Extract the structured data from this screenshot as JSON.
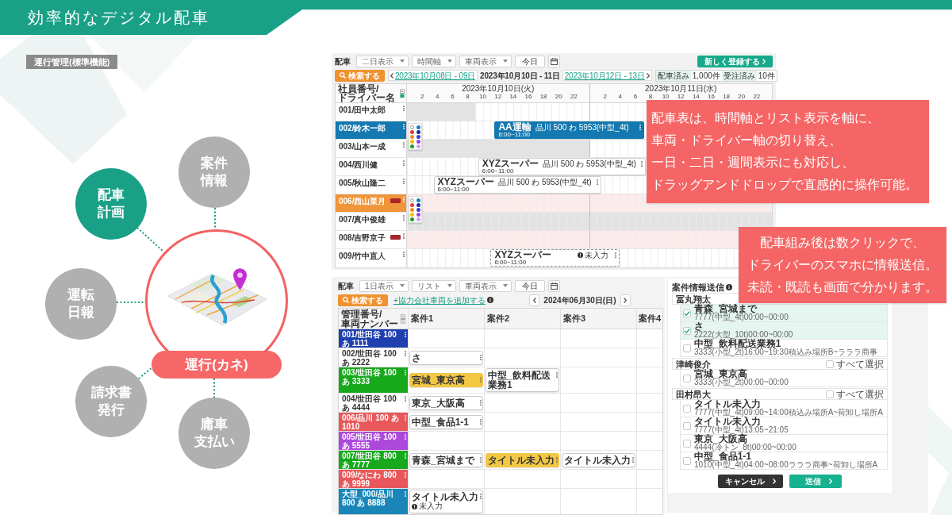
{
  "header": {
    "title": "効率的なデジタル配車"
  },
  "section_label": "運行管理(標準機能)",
  "diagram": {
    "nodes": [
      {
        "lines": [
          "配車",
          "計画"
        ],
        "selected": true
      },
      {
        "lines": [
          "案件",
          "情報"
        ],
        "selected": false
      },
      {
        "lines": [
          "運転",
          "日報"
        ],
        "selected": false
      },
      {
        "lines": [
          "請求書",
          "発行"
        ],
        "selected": false
      },
      {
        "lines": [
          "庸車",
          "支払い"
        ],
        "selected": false
      }
    ],
    "hub": {
      "label": "運行(カネ)"
    }
  },
  "dispatch_timeline": {
    "toolbar": {
      "label": "配車",
      "dropdowns": [
        "二日表示",
        "時間軸",
        "車両表示"
      ],
      "today_button": "今日",
      "new_button": "新しく登録する"
    },
    "search_button": "検索する",
    "date_nav": {
      "previous": "2023年10月08日 - 09日",
      "current": "2023年10月10日 - 11日",
      "next": "2023年10月12日 - 13日"
    },
    "stats": [
      {
        "label": "配車済み",
        "value": "1,000件"
      },
      {
        "label": "受注済み",
        "value": "10件"
      }
    ],
    "driver_header": "社員番号/ドライバー名",
    "days": [
      {
        "label": "2023年10月10日(火)",
        "hours": [
          "2",
          "4",
          "6",
          "8",
          "10",
          "12",
          "14",
          "16",
          "18",
          "20",
          "22"
        ]
      },
      {
        "label": "2023年10月11日(水)",
        "hours": [
          "2",
          "4",
          "6",
          "8",
          "10",
          "12",
          "14",
          "16",
          "18",
          "20",
          "22"
        ]
      }
    ],
    "palette_colors": [
      {
        "color": "#ffffff"
      },
      {
        "color": "#1b7db6"
      },
      {
        "color": "#e53935"
      },
      {
        "color": "#1e2a9e"
      },
      {
        "color": "#f28c28"
      },
      {
        "color": "#3b3bd6"
      },
      {
        "color": "#f2c200"
      },
      {
        "color": "#a23fe0"
      },
      {
        "color": "#1aa31a"
      },
      {
        "color": "#d79cf2"
      }
    ],
    "rows": [
      {
        "name": "001/田中太郎",
        "kind": "partial",
        "badge": false,
        "palette_open": false
      },
      {
        "name": "002/鈴木一郎",
        "color": "#1479b0",
        "kind": "open",
        "badge": false,
        "palette_open": true,
        "job": {
          "kind": "filled",
          "title": "AA運輸",
          "vehicle": "品川 500 わ 5953(中型_4t)",
          "time": "6:00~11:00"
        }
      },
      {
        "name": "003/山本一成",
        "kind": "halfblocked",
        "badge": false,
        "palette_open": false
      },
      {
        "name": "004/西川健",
        "kind": "open",
        "badge": false,
        "palette_open": false,
        "job": {
          "kind": "outline",
          "title": "XYZスーパー",
          "vehicle": "品川 500 わ 5953(中型_4t)",
          "time": "6:00~11:00"
        }
      },
      {
        "name": "005/秋山隆二",
        "kind": "open",
        "badge": false,
        "palette_open": false,
        "job": {
          "kind": "outline",
          "title": "XYZスーパー",
          "vehicle": "品川 500 わ 5953(中型_4t)",
          "time": "6:00~11:00"
        }
      },
      {
        "name": "006/西山菜月",
        "color": "#f0953a",
        "kind": "holiday",
        "badge": true,
        "palette_open": true
      },
      {
        "name": "007/真中俊雄",
        "kind": "blocked",
        "badge": false,
        "palette_open": false
      },
      {
        "name": "008/吉野京子",
        "kind": "holiday",
        "badge": true,
        "palette_open": false
      },
      {
        "name": "009/竹中直人",
        "kind": "open",
        "badge": false,
        "palette_open": false,
        "job": {
          "kind": "dashed",
          "title": "XYZスーパー",
          "status": "未入力",
          "time": "6:00~11:00"
        }
      }
    ]
  },
  "dispatch_list": {
    "toolbar": {
      "label": "配車",
      "dropdowns": [
        "1日表示",
        "リスト",
        "車両表示"
      ],
      "today_button": "今日"
    },
    "search_button": "検索する",
    "add_link": "+協力会社車両を追加する",
    "date": "2024年06月30日(日)",
    "columns": [
      "管理番号/車両ナンバー",
      "案件1",
      "案件2",
      "案件3",
      "案件4"
    ],
    "rows": [
      {
        "vehicle": "001/世田谷 100 あ 1111",
        "color": "#1f3fae"
      },
      {
        "vehicle": "002/世田谷 100 あ 2222",
        "jobs": [
          {
            "title": "さ",
            "kind": "plain"
          }
        ]
      },
      {
        "vehicle": "003/世田谷 100 あ 3333",
        "color": "#17a81c",
        "jobs": [
          {
            "title": "宮城_東京高",
            "kind": "highlight"
          },
          {
            "title": "中型_飲料配送業務1",
            "kind": "plain"
          }
        ]
      },
      {
        "vehicle": "004/世田谷 100 あ 4444",
        "jobs": [
          {
            "title": "東京_大阪高",
            "kind": "plain"
          }
        ]
      },
      {
        "vehicle": "006/品川 100 あ 1010",
        "color": "#e8585a",
        "jobs": [
          {
            "title": "中型_食品1-1",
            "kind": "plain"
          }
        ]
      },
      {
        "vehicle": "005/世田谷 100 あ 5555",
        "color": "#ac48dc"
      },
      {
        "vehicle": "007/世田谷 800 あ 7777",
        "color": "#17a81c",
        "jobs": [
          {
            "title": "青森_宮城まで",
            "kind": "plain"
          },
          {
            "title": "タイトル未入力",
            "kind": "highlight"
          },
          {
            "title": "タイトル未入力",
            "kind": "plain"
          }
        ]
      },
      {
        "vehicle": "009/なにわ 800 あ 9999",
        "color": "#e8585a"
      },
      {
        "vehicle": "大型_000/品川 800 あ 8888",
        "color": "#1a86b8",
        "jobs": [
          {
            "title": "タイトル未入力",
            "kind": "plain",
            "status": "未入力"
          }
        ]
      }
    ]
  },
  "send_panel": {
    "title": "案件情報送信",
    "groups": [
      {
        "name": "冨丸翔太",
        "items": [
          {
            "title": "青森_宮城まで",
            "detail": "7777(中型_4t)00:00~00:00",
            "checked": true
          },
          {
            "title": "さ",
            "detail": "2222(大型_10t)00:00~00:00",
            "checked": true
          },
          {
            "title": "中型_飲料配送業務1",
            "detail": "3333(小型_2t)16:00~19:30積込み場所B~ラララ商事",
            "checked": false
          }
        ]
      },
      {
        "name": "津崎俊介",
        "select_all": {
          "label": "すべて選択",
          "checked": false
        },
        "items": [
          {
            "title": "宮城_東京高",
            "detail": "3333(小型_2t)00:00~00:00",
            "checked": false
          }
        ]
      },
      {
        "name": "田村昂大",
        "select_all": {
          "label": "すべて選択",
          "checked": false
        },
        "items": [
          {
            "title": "タイトル未入力",
            "detail": "7777(中型_4t)09:00~14:00積込み場所A~荷卸し場所A",
            "checked": false
          },
          {
            "title": "タイトル未入力",
            "detail": "7777(中型_4t)13:05~21:05",
            "checked": false
          },
          {
            "title": "東京_大阪高",
            "detail": "4444(冷トン_8t)00:00~00:00",
            "checked": false
          },
          {
            "title": "中型_食品1-1",
            "detail": "1010(中型_4t)04:00~08:00ラララ商事~荷卸し場所A",
            "checked": false
          }
        ]
      }
    ],
    "buttons": [
      {
        "label": "キャンセル",
        "kind": "secondary"
      },
      {
        "label": "送信",
        "kind": "primary"
      }
    ]
  },
  "callouts": [
    {
      "lines": [
        "配車表は、時間軸とリスト表示を軸に、",
        "車両・ドライバー軸の切り替え、",
        "一日・二日・週間表示にも対応し、",
        "ドラッグアンドドロップで直感的に操作可能。"
      ]
    },
    {
      "lines": [
        "配車組み後は数クリックで、",
        "ドライバーのスマホに情報送信。",
        "未読・既読も画面で分かります。"
      ]
    }
  ]
}
